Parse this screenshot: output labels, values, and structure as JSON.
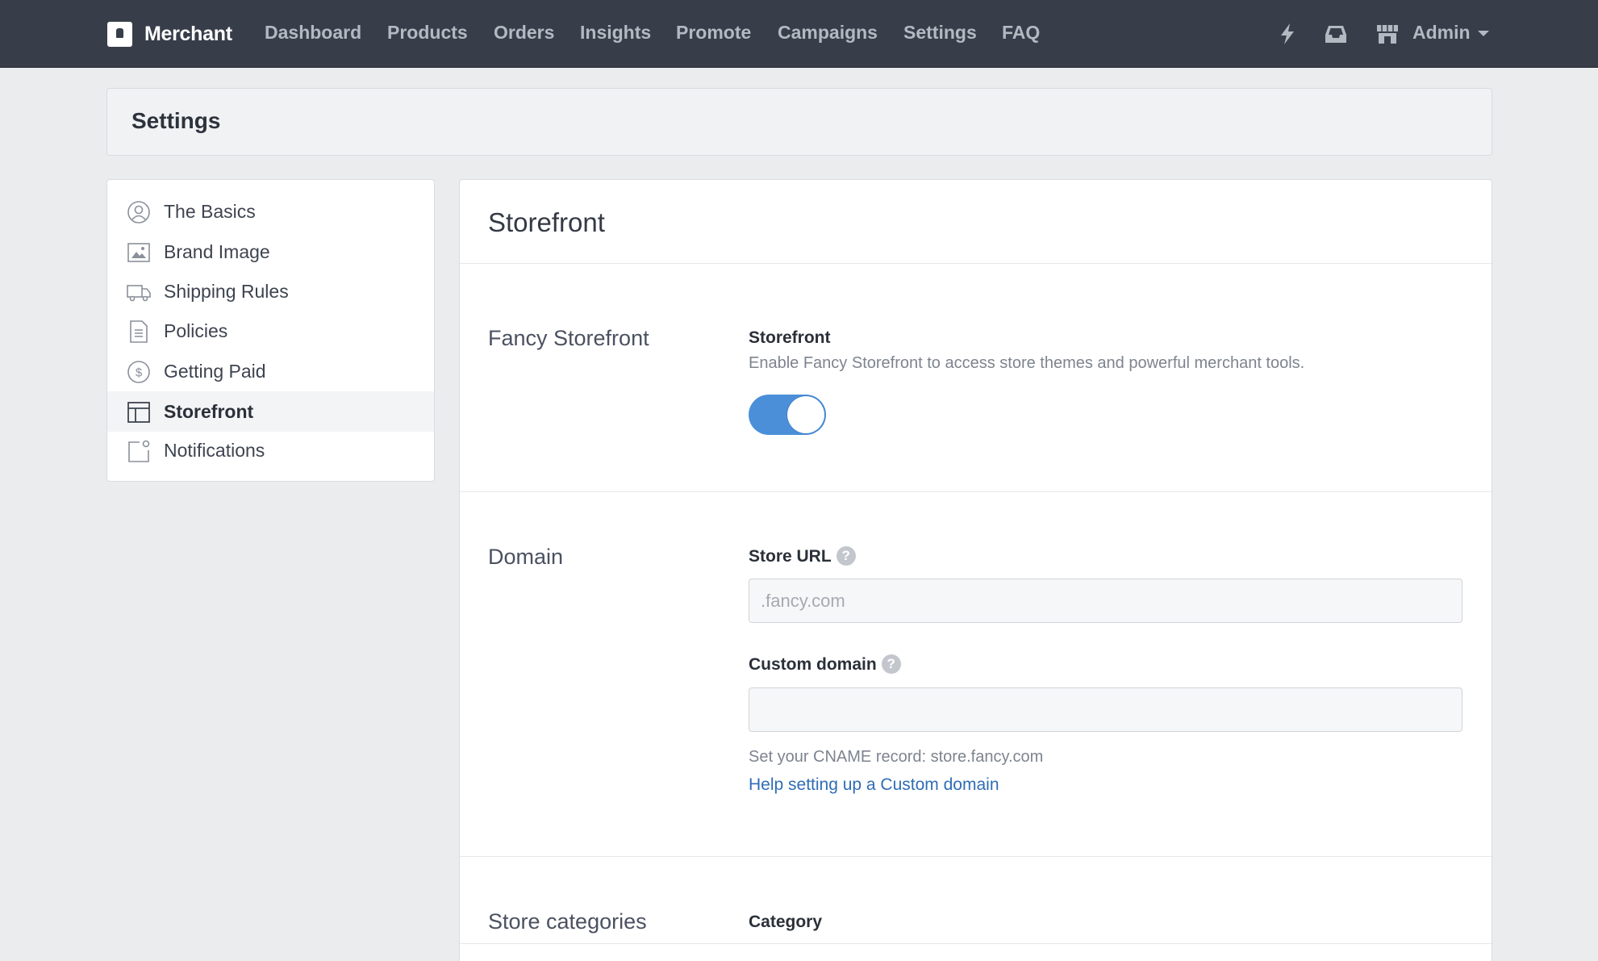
{
  "brand": {
    "name": "Merchant"
  },
  "nav": [
    {
      "label": "Dashboard"
    },
    {
      "label": "Products"
    },
    {
      "label": "Orders"
    },
    {
      "label": "Insights"
    },
    {
      "label": "Promote"
    },
    {
      "label": "Campaigns"
    },
    {
      "label": "Settings"
    },
    {
      "label": "FAQ"
    }
  ],
  "top_right": {
    "icons": [
      "lightning-icon",
      "inbox-icon",
      "store-icon"
    ],
    "account_label": "Admin"
  },
  "page_header": {
    "title": "Settings"
  },
  "sidebar": {
    "items": [
      {
        "label": "The Basics",
        "icon": "user-circle-icon",
        "active": false
      },
      {
        "label": "Brand Image",
        "icon": "image-icon",
        "active": false
      },
      {
        "label": "Shipping Rules",
        "icon": "truck-icon",
        "active": false
      },
      {
        "label": "Policies",
        "icon": "document-icon",
        "active": false
      },
      {
        "label": "Getting Paid",
        "icon": "dollar-circle-icon",
        "active": false
      },
      {
        "label": "Storefront",
        "icon": "layout-icon",
        "active": true
      },
      {
        "label": "Notifications",
        "icon": "notification-icon",
        "active": false
      }
    ]
  },
  "main": {
    "title": "Storefront",
    "fancy_section": {
      "title": "Fancy Storefront",
      "field_label": "Storefront",
      "description": "Enable Fancy Storefront to access store themes and powerful merchant tools.",
      "toggle_on": true
    },
    "domain_section": {
      "title": "Domain",
      "store_url_label": "Store URL",
      "store_url_placeholder": ".fancy.com",
      "store_url_value": "",
      "custom_domain_label": "Custom domain",
      "custom_domain_value": "",
      "cname_text": "Set your CNAME record: store.fancy.com",
      "help_link": "Help setting up a Custom domain",
      "help_icon": "?"
    },
    "categories_section": {
      "title": "Store categories",
      "field_label": "Category"
    }
  },
  "colors": {
    "topbar": "#373e4a",
    "accent": "#4a8fd8",
    "link": "#2f6db5",
    "page_bg": "#ebecee"
  }
}
